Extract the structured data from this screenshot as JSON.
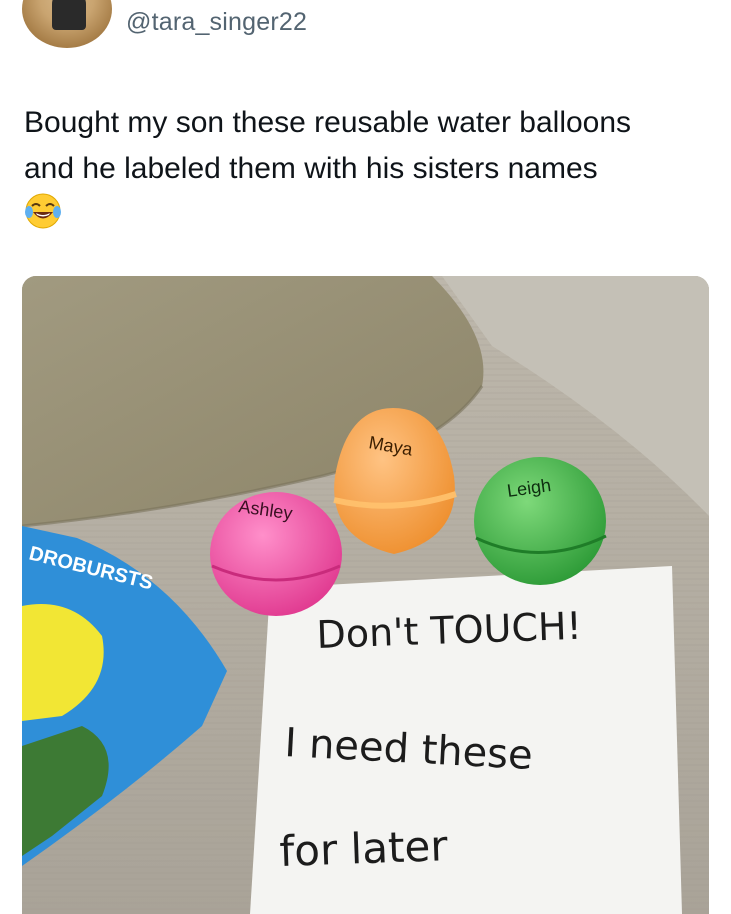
{
  "user": {
    "handle": "@tara_singer22"
  },
  "tweet": {
    "line1": "Bought my son these reusable water balloons",
    "line2": "and he labeled them with his sisters names",
    "emoji": "face-with-tears-of-joy-icon"
  },
  "photo": {
    "balloons": [
      {
        "label": "Ashley",
        "color": "#ee4fa3"
      },
      {
        "label": "Maya",
        "color": "#f4a048"
      },
      {
        "label": "Leigh",
        "color": "#3fb44a"
      }
    ],
    "package_text": "DROBURSTS",
    "note": {
      "line1": "Don't TOUCH!",
      "line2": "I need these",
      "line3": "for later"
    }
  }
}
